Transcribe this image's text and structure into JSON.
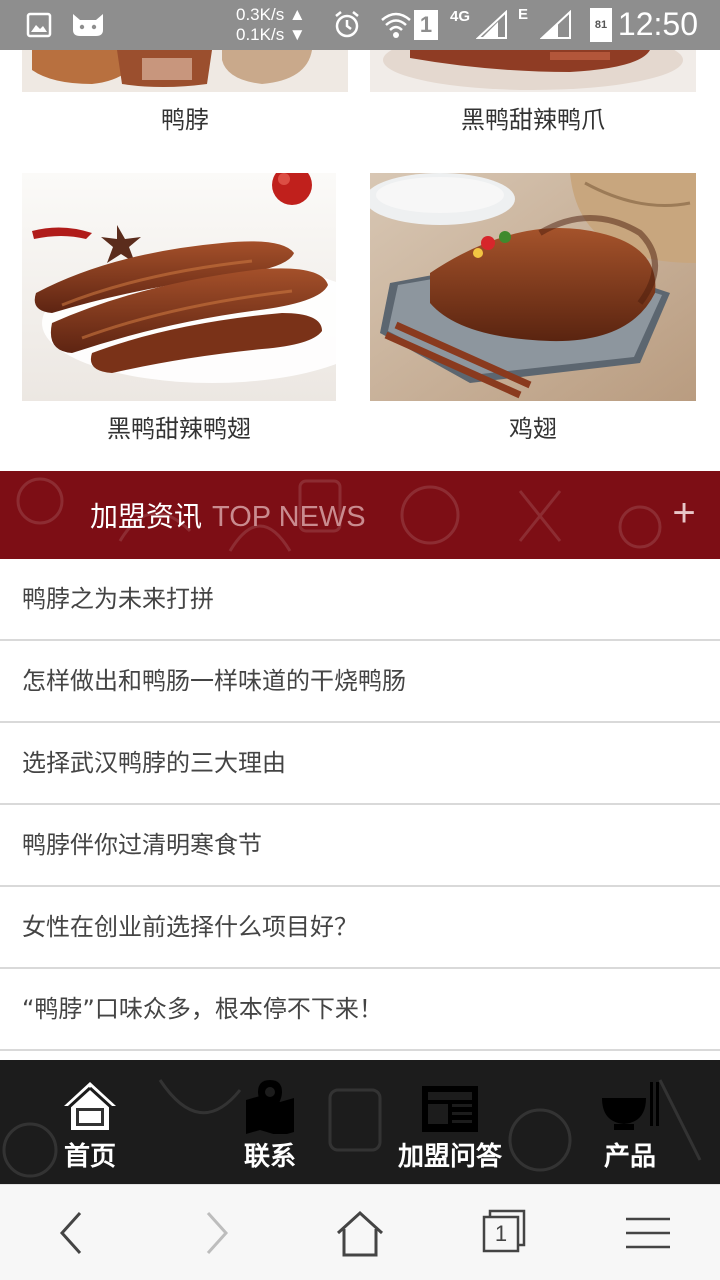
{
  "status_bar": {
    "net_up": "0.3K/s ▲",
    "net_down": "0.1K/s ▼",
    "sim_badge": "1",
    "network": "4G",
    "network_e": "E",
    "battery": "81",
    "time": "12:50"
  },
  "products": [
    {
      "label": "鸭脖",
      "icon": "duck-neck-image"
    },
    {
      "label": "黑鸭甜辣鸭爪",
      "icon": "duck-feet-image"
    },
    {
      "label": "黑鸭甜辣鸭翅",
      "icon": "duck-wing-image"
    },
    {
      "label": "鸡翅",
      "icon": "chicken-wing-image"
    }
  ],
  "news": {
    "title_cn": "加盟资讯",
    "title_en": "TOP NEWS",
    "plus": "+",
    "items": [
      "鸭脖之为未来打拼",
      "怎样做出和鸭肠一样味道的干烧鸭肠",
      "选择武汉鸭脖的三大理由",
      "鸭脖伴你过清明寒食节",
      "女性在创业前选择什么项目好？",
      "“鸭脖”口味众多，根本停不下来！"
    ]
  },
  "bottom_nav": [
    {
      "label": "首页",
      "icon": "home-icon"
    },
    {
      "label": "联系",
      "icon": "map-icon"
    },
    {
      "label": "加盟问答",
      "icon": "newspaper-icon"
    },
    {
      "label": "产品",
      "icon": "bowl-icon"
    }
  ],
  "browser": {
    "tab_count": "1"
  },
  "colors": {
    "news_header_bg": "#7d0e15",
    "nav_bg": "#1c1c1c",
    "status_bar_bg": "#8e8e8e"
  }
}
